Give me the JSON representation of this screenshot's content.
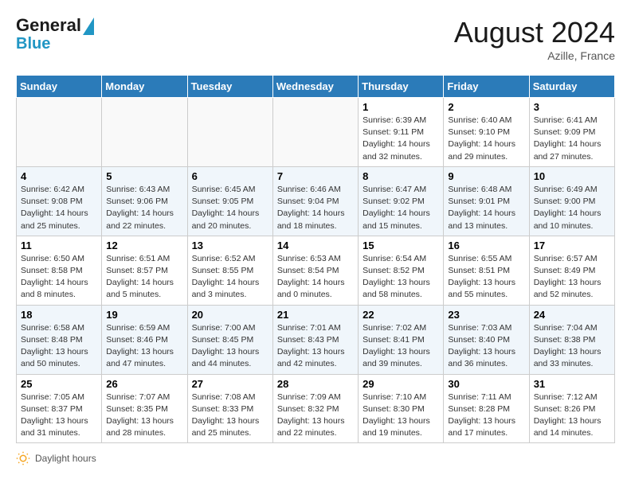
{
  "header": {
    "logo_line1": "General",
    "logo_line2": "Blue",
    "month": "August 2024",
    "location": "Azille, France"
  },
  "days_of_week": [
    "Sunday",
    "Monday",
    "Tuesday",
    "Wednesday",
    "Thursday",
    "Friday",
    "Saturday"
  ],
  "weeks": [
    [
      {
        "num": "",
        "empty": true
      },
      {
        "num": "",
        "empty": true
      },
      {
        "num": "",
        "empty": true
      },
      {
        "num": "",
        "empty": true
      },
      {
        "num": "1",
        "sunrise": "6:39 AM",
        "sunset": "9:11 PM",
        "daylight": "14 hours and 32 minutes."
      },
      {
        "num": "2",
        "sunrise": "6:40 AM",
        "sunset": "9:10 PM",
        "daylight": "14 hours and 29 minutes."
      },
      {
        "num": "3",
        "sunrise": "6:41 AM",
        "sunset": "9:09 PM",
        "daylight": "14 hours and 27 minutes."
      }
    ],
    [
      {
        "num": "4",
        "sunrise": "6:42 AM",
        "sunset": "9:08 PM",
        "daylight": "14 hours and 25 minutes."
      },
      {
        "num": "5",
        "sunrise": "6:43 AM",
        "sunset": "9:06 PM",
        "daylight": "14 hours and 22 minutes."
      },
      {
        "num": "6",
        "sunrise": "6:45 AM",
        "sunset": "9:05 PM",
        "daylight": "14 hours and 20 minutes."
      },
      {
        "num": "7",
        "sunrise": "6:46 AM",
        "sunset": "9:04 PM",
        "daylight": "14 hours and 18 minutes."
      },
      {
        "num": "8",
        "sunrise": "6:47 AM",
        "sunset": "9:02 PM",
        "daylight": "14 hours and 15 minutes."
      },
      {
        "num": "9",
        "sunrise": "6:48 AM",
        "sunset": "9:01 PM",
        "daylight": "14 hours and 13 minutes."
      },
      {
        "num": "10",
        "sunrise": "6:49 AM",
        "sunset": "9:00 PM",
        "daylight": "14 hours and 10 minutes."
      }
    ],
    [
      {
        "num": "11",
        "sunrise": "6:50 AM",
        "sunset": "8:58 PM",
        "daylight": "14 hours and 8 minutes."
      },
      {
        "num": "12",
        "sunrise": "6:51 AM",
        "sunset": "8:57 PM",
        "daylight": "14 hours and 5 minutes."
      },
      {
        "num": "13",
        "sunrise": "6:52 AM",
        "sunset": "8:55 PM",
        "daylight": "14 hours and 3 minutes."
      },
      {
        "num": "14",
        "sunrise": "6:53 AM",
        "sunset": "8:54 PM",
        "daylight": "14 hours and 0 minutes."
      },
      {
        "num": "15",
        "sunrise": "6:54 AM",
        "sunset": "8:52 PM",
        "daylight": "13 hours and 58 minutes."
      },
      {
        "num": "16",
        "sunrise": "6:55 AM",
        "sunset": "8:51 PM",
        "daylight": "13 hours and 55 minutes."
      },
      {
        "num": "17",
        "sunrise": "6:57 AM",
        "sunset": "8:49 PM",
        "daylight": "13 hours and 52 minutes."
      }
    ],
    [
      {
        "num": "18",
        "sunrise": "6:58 AM",
        "sunset": "8:48 PM",
        "daylight": "13 hours and 50 minutes."
      },
      {
        "num": "19",
        "sunrise": "6:59 AM",
        "sunset": "8:46 PM",
        "daylight": "13 hours and 47 minutes."
      },
      {
        "num": "20",
        "sunrise": "7:00 AM",
        "sunset": "8:45 PM",
        "daylight": "13 hours and 44 minutes."
      },
      {
        "num": "21",
        "sunrise": "7:01 AM",
        "sunset": "8:43 PM",
        "daylight": "13 hours and 42 minutes."
      },
      {
        "num": "22",
        "sunrise": "7:02 AM",
        "sunset": "8:41 PM",
        "daylight": "13 hours and 39 minutes."
      },
      {
        "num": "23",
        "sunrise": "7:03 AM",
        "sunset": "8:40 PM",
        "daylight": "13 hours and 36 minutes."
      },
      {
        "num": "24",
        "sunrise": "7:04 AM",
        "sunset": "8:38 PM",
        "daylight": "13 hours and 33 minutes."
      }
    ],
    [
      {
        "num": "25",
        "sunrise": "7:05 AM",
        "sunset": "8:37 PM",
        "daylight": "13 hours and 31 minutes."
      },
      {
        "num": "26",
        "sunrise": "7:07 AM",
        "sunset": "8:35 PM",
        "daylight": "13 hours and 28 minutes."
      },
      {
        "num": "27",
        "sunrise": "7:08 AM",
        "sunset": "8:33 PM",
        "daylight": "13 hours and 25 minutes."
      },
      {
        "num": "28",
        "sunrise": "7:09 AM",
        "sunset": "8:32 PM",
        "daylight": "13 hours and 22 minutes."
      },
      {
        "num": "29",
        "sunrise": "7:10 AM",
        "sunset": "8:30 PM",
        "daylight": "13 hours and 19 minutes."
      },
      {
        "num": "30",
        "sunrise": "7:11 AM",
        "sunset": "8:28 PM",
        "daylight": "13 hours and 17 minutes."
      },
      {
        "num": "31",
        "sunrise": "7:12 AM",
        "sunset": "8:26 PM",
        "daylight": "13 hours and 14 minutes."
      }
    ]
  ],
  "footer": {
    "label": "Daylight hours"
  }
}
